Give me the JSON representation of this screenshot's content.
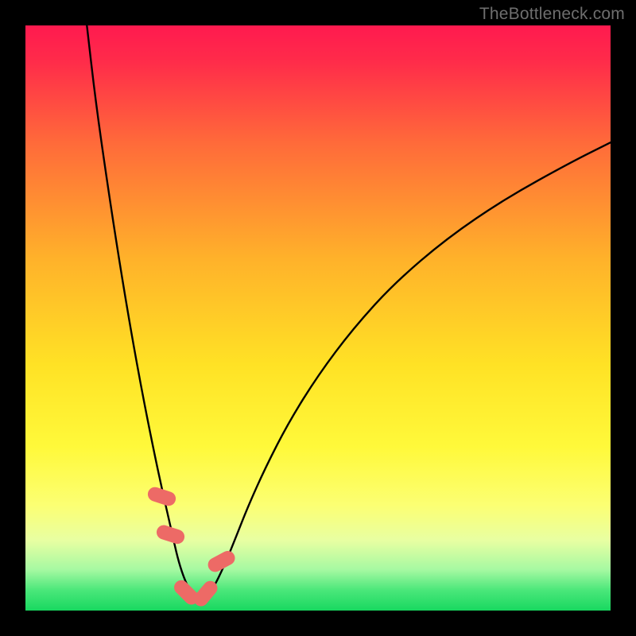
{
  "watermark": "TheBottleneck.com",
  "chart_data": {
    "type": "line",
    "title": "",
    "xlabel": "",
    "ylabel": "",
    "xlim": [
      0,
      100
    ],
    "ylim": [
      0,
      100
    ],
    "gradient_stops": [
      {
        "pos": 0.0,
        "color": "#ff1a4f"
      },
      {
        "pos": 0.06,
        "color": "#ff2b4a"
      },
      {
        "pos": 0.2,
        "color": "#ff6a3a"
      },
      {
        "pos": 0.4,
        "color": "#ffb22a"
      },
      {
        "pos": 0.58,
        "color": "#ffe225"
      },
      {
        "pos": 0.72,
        "color": "#fff93a"
      },
      {
        "pos": 0.82,
        "color": "#fcff73"
      },
      {
        "pos": 0.88,
        "color": "#e8ffa2"
      },
      {
        "pos": 0.93,
        "color": "#a6f9a2"
      },
      {
        "pos": 0.965,
        "color": "#4be77a"
      },
      {
        "pos": 1.0,
        "color": "#18d860"
      }
    ],
    "series": [
      {
        "name": "bottleneck-curve",
        "x": [
          10.5,
          12,
          14,
          16,
          18,
          20,
          22,
          23.5,
          25,
          26,
          27,
          28,
          28.8,
          29.6,
          30.5,
          32,
          34,
          36,
          38,
          41,
          45,
          50,
          56,
          63,
          72,
          82,
          93,
          100
        ],
        "y": [
          100,
          87,
          73,
          60,
          48,
          37,
          27,
          20,
          13.5,
          9,
          5.8,
          3.6,
          2.3,
          1.8,
          2.0,
          3.6,
          7.7,
          12.6,
          17.7,
          24.4,
          32.2,
          40.2,
          48.2,
          55.9,
          63.6,
          70.4,
          76.5,
          80.0
        ]
      }
    ],
    "markers": [
      {
        "name": "marker-left-upper",
        "x": 23.3,
        "y": 19.5,
        "angle": -72
      },
      {
        "name": "marker-left-lower",
        "x": 24.8,
        "y": 13.0,
        "angle": -72
      },
      {
        "name": "marker-floor-left",
        "x": 27.5,
        "y": 3.1,
        "angle": -45
      },
      {
        "name": "marker-floor-right",
        "x": 30.8,
        "y": 2.9,
        "angle": 40
      },
      {
        "name": "marker-right-upper",
        "x": 33.5,
        "y": 8.4,
        "angle": 62
      }
    ],
    "marker_style": {
      "fill": "#ed6a66",
      "w": 18,
      "h": 36,
      "rx": 9
    },
    "curve_style": {
      "stroke": "#000000",
      "stroke_width": 2.4
    }
  }
}
